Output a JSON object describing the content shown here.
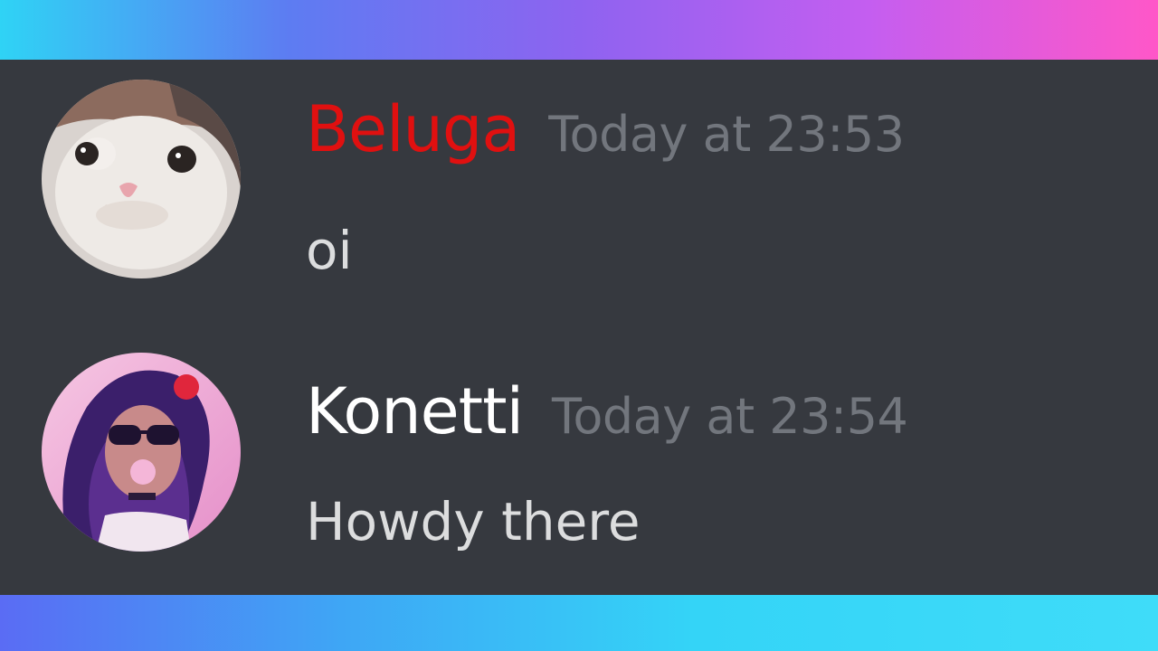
{
  "colors": {
    "background": "#36393f",
    "timestamp": "#72767d",
    "message_text": "#dcddde",
    "top_band_gradient": [
      "#2fd3f5",
      "#8e63f0",
      "#ff57c8"
    ],
    "bottom_band_gradient": [
      "#5a6cf4",
      "#34d4f7"
    ]
  },
  "messages": [
    {
      "username": "Beluga",
      "username_color": "#e01010",
      "timestamp": "Today at 23:53",
      "text": "oi",
      "avatar_icon": "cat-avatar"
    },
    {
      "username": "Konetti",
      "username_color": "#ffffff",
      "timestamp": "Today at 23:54",
      "text": "Howdy there",
      "avatar_icon": "woman-avatar"
    }
  ]
}
